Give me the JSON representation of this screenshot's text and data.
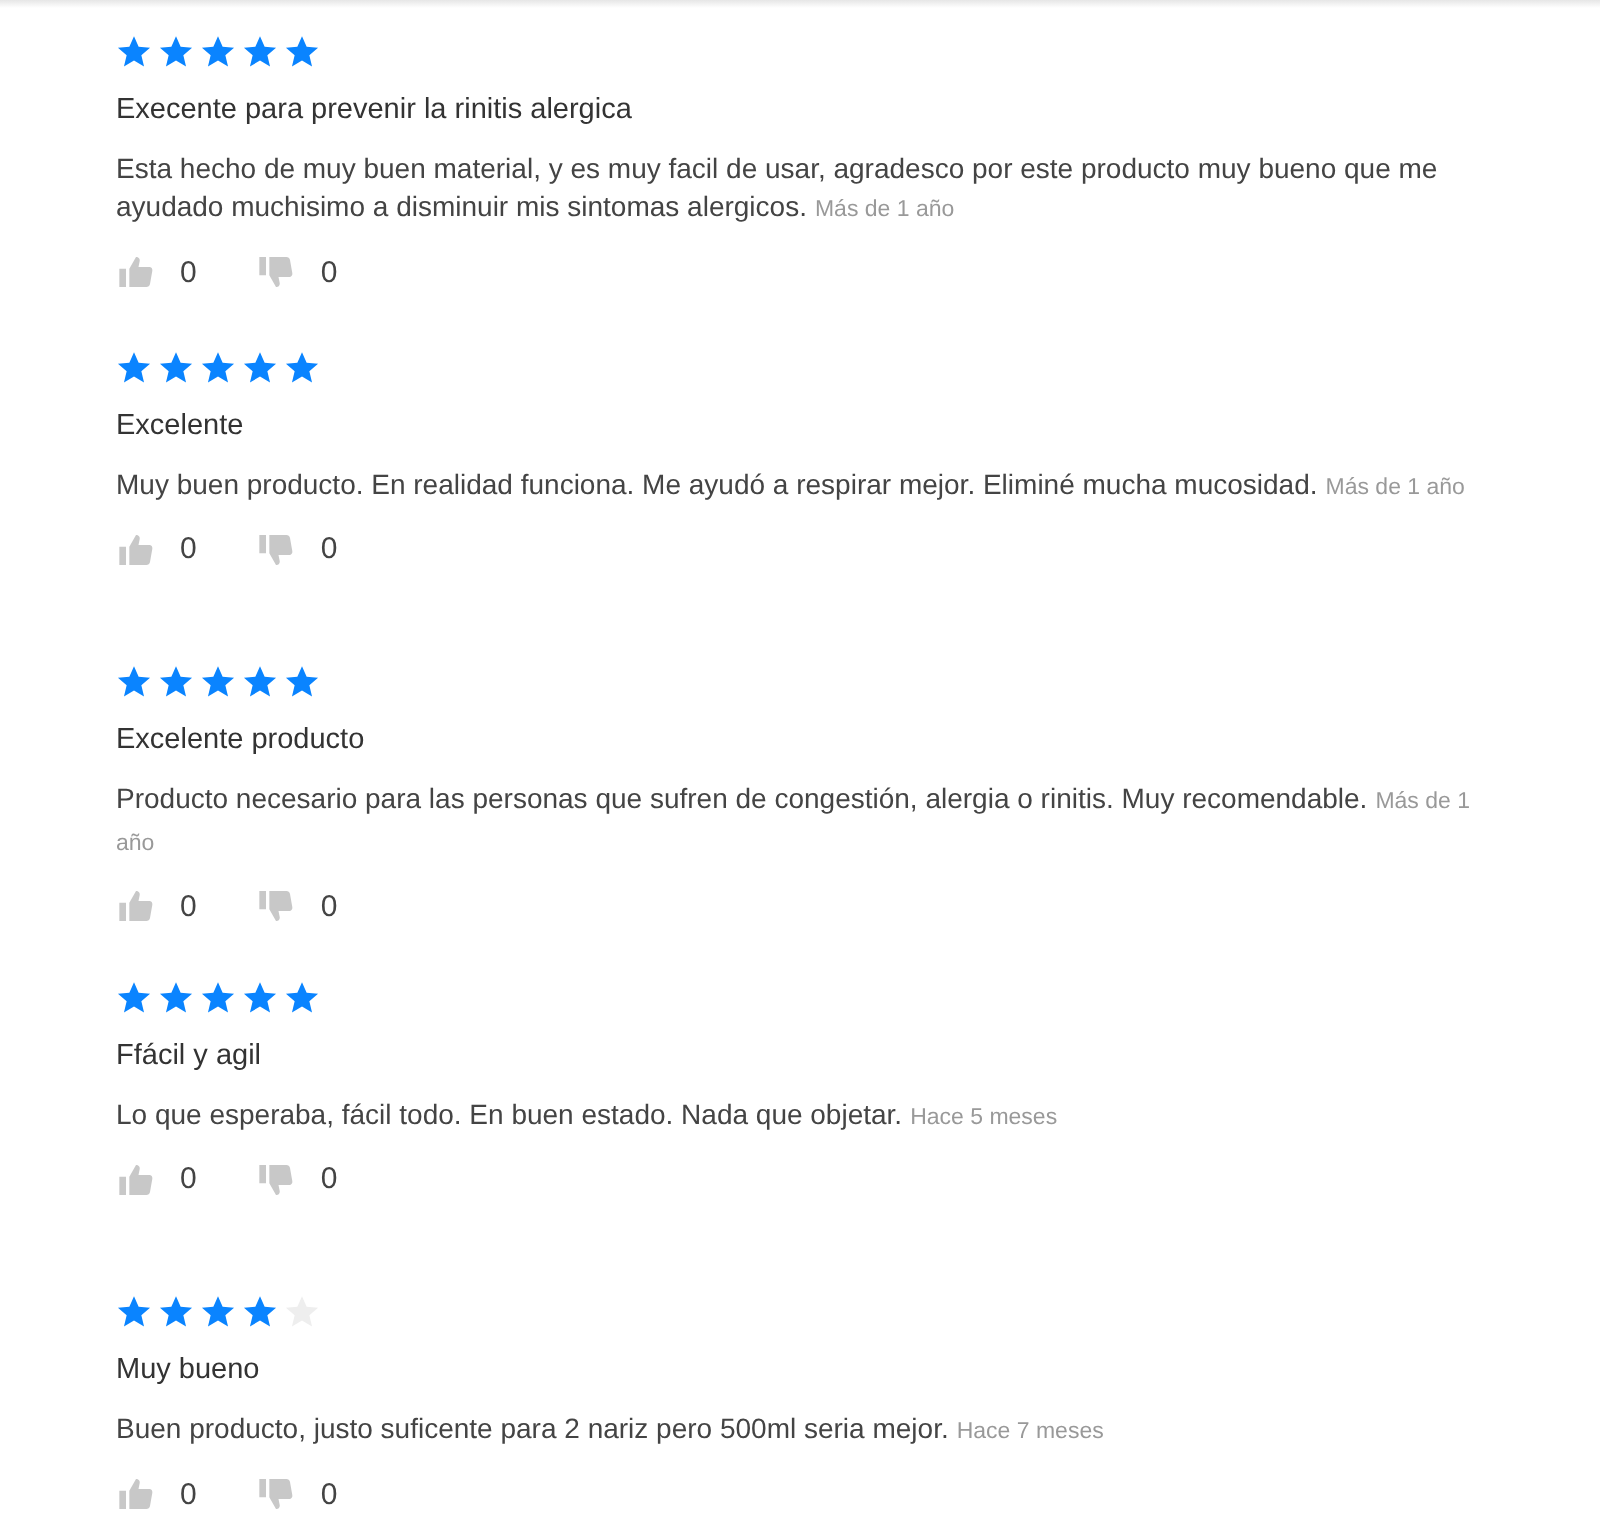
{
  "reviews": [
    {
      "stars": 5,
      "title": "Execente para prevenir la rinitis alergica",
      "body": "Esta hecho de muy buen material, y es muy facil de usar, agradesco por este producto muy bueno que me ayudado muchisimo a disminuir mis sintomas alergicos.",
      "date": "Más de 1 año",
      "likes": "0",
      "dislikes": "0"
    },
    {
      "stars": 5,
      "title": "Excelente",
      "body": "Muy buen producto. En realidad funciona. Me ayudó a respirar mejor. Eliminé mucha mucosidad.",
      "date": "Más de 1 año",
      "likes": "0",
      "dislikes": "0"
    },
    {
      "stars": 5,
      "title": "Excelente producto",
      "body": "Producto necesario para las personas que sufren de congestión, alergia o rinitis. Muy recomendable.",
      "date": "Más de 1 año",
      "likes": "0",
      "dislikes": "0"
    },
    {
      "stars": 5,
      "title": "Ffácil y agil",
      "body": "Lo que esperaba, fácil todo. En buen estado. Nada que objetar.",
      "date": "Hace 5 meses",
      "likes": "0",
      "dislikes": "0"
    },
    {
      "stars": 4,
      "title": "Muy bueno",
      "body": "Buen producto, justo suficente para 2 nariz pero 500ml seria mejor.",
      "date": "Hace 7 meses",
      "likes": "0",
      "dislikes": "0"
    }
  ]
}
